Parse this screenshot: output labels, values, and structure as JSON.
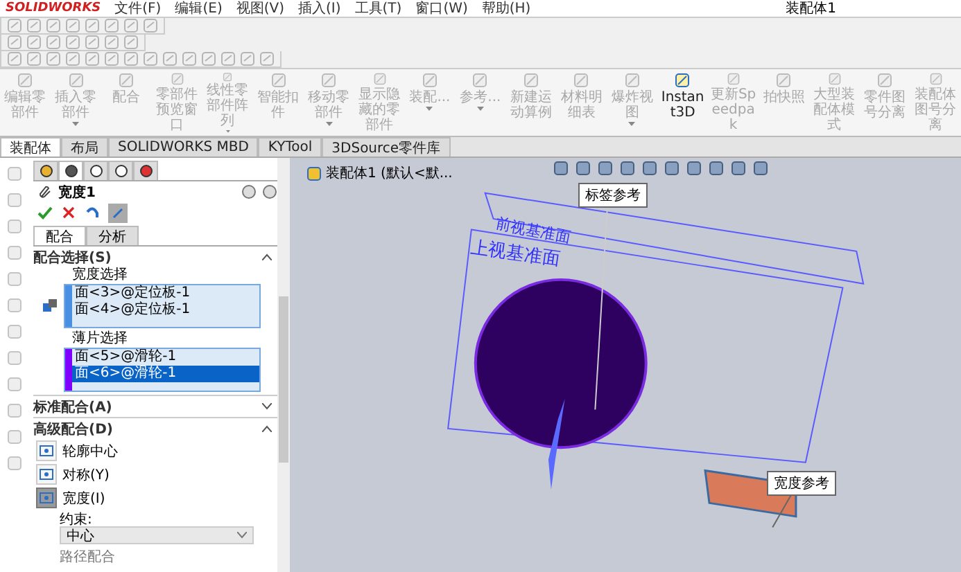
{
  "titlebar": {
    "logo": "SOLIDWORKS",
    "menus": [
      "文件(F)",
      "编辑(E)",
      "视图(V)",
      "插入(I)",
      "工具(T)",
      "窗口(W)",
      "帮助(H)"
    ],
    "document_title": "装配体1"
  },
  "command_manager": [
    {
      "label": "编辑零部件",
      "disabled": true,
      "dropdown": false
    },
    {
      "label": "插入零部件",
      "disabled": true,
      "dropdown": true
    },
    {
      "label": "配合",
      "disabled": true,
      "dropdown": false
    },
    {
      "label": "零部件预览窗口",
      "disabled": true,
      "dropdown": false
    },
    {
      "label": "线性零部件阵列",
      "disabled": true,
      "dropdown": true
    },
    {
      "label": "智能扣件",
      "disabled": true,
      "dropdown": false
    },
    {
      "label": "移动零部件",
      "disabled": true,
      "dropdown": true
    },
    {
      "label": "显示隐藏的零部件",
      "disabled": true,
      "dropdown": false
    },
    {
      "label": "装配...",
      "disabled": true,
      "dropdown": true
    },
    {
      "label": "参考...",
      "disabled": true,
      "dropdown": true
    },
    {
      "label": "新建运动算例",
      "disabled": true,
      "dropdown": false
    },
    {
      "label": "材料明细表",
      "disabled": true,
      "dropdown": false
    },
    {
      "label": "爆炸视图",
      "disabled": true,
      "dropdown": true
    },
    {
      "label": "Instant3D",
      "disabled": false,
      "dropdown": false
    },
    {
      "label": "更新Speedpak",
      "disabled": true,
      "dropdown": false
    },
    {
      "label": "拍快照",
      "disabled": true,
      "dropdown": false
    },
    {
      "label": "大型装配体模式",
      "disabled": true,
      "dropdown": false
    },
    {
      "label": "零件图号分离",
      "disabled": true,
      "dropdown": false
    },
    {
      "label": "装配体图号分离",
      "disabled": true,
      "dropdown": false
    }
  ],
  "tabs": [
    {
      "label": "装配体",
      "selected": true
    },
    {
      "label": "布局",
      "selected": false
    },
    {
      "label": "SOLIDWORKS MBD",
      "selected": false
    },
    {
      "label": "KYTool",
      "selected": false
    },
    {
      "label": "3DSource零件库",
      "selected": false
    }
  ],
  "property_manager": {
    "panel_tabs": [
      {
        "selected": false
      },
      {
        "selected": true
      },
      {
        "selected": false
      },
      {
        "selected": false
      },
      {
        "selected": false
      }
    ],
    "title": "宽度1",
    "subtabs": [
      {
        "label": "配合",
        "selected": true
      },
      {
        "label": "分析",
        "selected": false
      }
    ],
    "mate_selections": {
      "header": "配合选择(S)",
      "expanded": true,
      "boxes": [
        {
          "label": "宽度选择",
          "color": "#4a90e2",
          "items": [
            {
              "text": "面<3>@定位板-1",
              "selected": false
            },
            {
              "text": "面<4>@定位板-1",
              "selected": false
            }
          ]
        },
        {
          "label": "薄片选择",
          "color": "#8000ff",
          "items": [
            {
              "text": "面<5>@滑轮-1",
              "selected": false
            },
            {
              "text": "面<6>@滑轮-1",
              "selected": true
            }
          ]
        }
      ]
    },
    "standard_mates": {
      "header": "标准配合(A)",
      "expanded": false
    },
    "advanced_mates": {
      "header": "高级配合(D)",
      "expanded": true,
      "options": [
        {
          "label": "轮廓中心",
          "selected": false
        },
        {
          "label": "对称(Y)",
          "selected": false
        },
        {
          "label": "宽度(I)",
          "selected": true
        }
      ],
      "constraint_label": "约束:",
      "constraint_value": "中心",
      "next_option": "路径配合"
    }
  },
  "viewport": {
    "tree_item": "装配体1 (默认<默...",
    "plane_labels": [
      "前视基准面",
      "上视基准面"
    ],
    "callouts": [
      "标签参考",
      "宽度参考"
    ]
  }
}
